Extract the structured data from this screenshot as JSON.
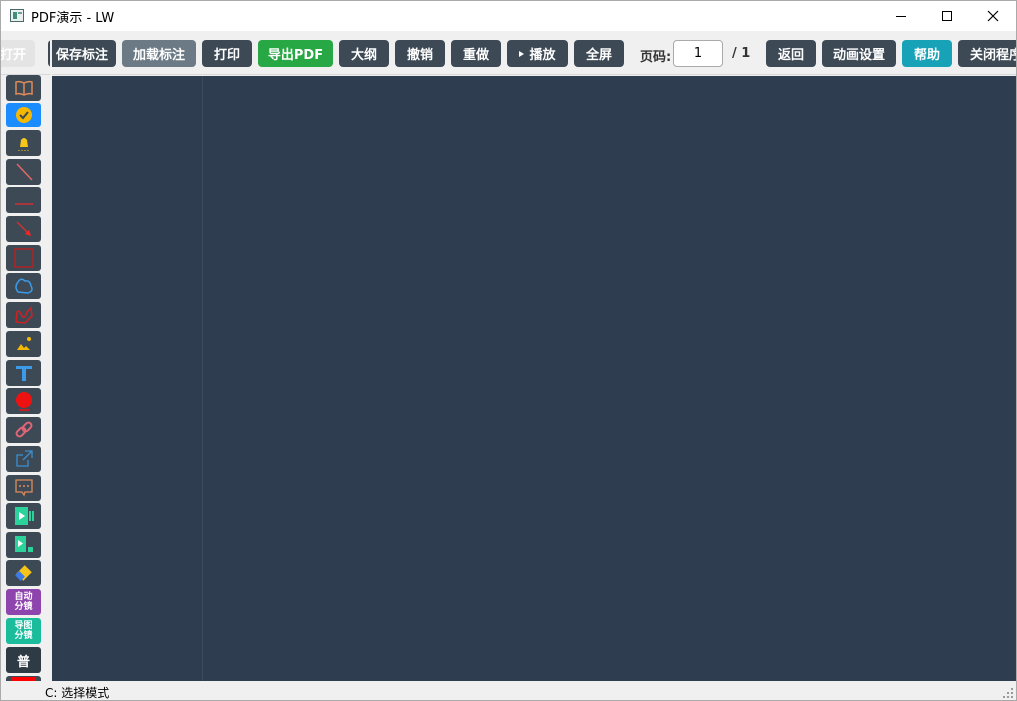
{
  "window": {
    "title": "PDF演示 - LW"
  },
  "toolbar": {
    "open_label": "打开",
    "save_annotation_label": "保存标注",
    "load_annotation_label": "加载标注",
    "print_label": "打印",
    "export_pdf_label": "导出PDF",
    "outline_label": "大纲",
    "undo_label": "撤销",
    "redo_label": "重做",
    "play_label": "播放",
    "fullscreen_label": "全屏",
    "page_label": "页码:",
    "page_value": "1",
    "page_total": "/ 1",
    "back_label": "返回",
    "animation_settings_label": "动画设置",
    "help_label": "帮助",
    "close_program_label": "关闭程序",
    "colors": {
      "primary": "#3d4a55",
      "secondary": "#6c7a86",
      "success": "#28a745",
      "info": "#17a2b8"
    }
  },
  "sidebar": {
    "tools": [
      {
        "name": "outline-book-icon"
      },
      {
        "name": "select-check-icon",
        "active": true
      },
      {
        "name": "bell-icon"
      },
      {
        "name": "line-icon"
      },
      {
        "name": "dash-line-icon"
      },
      {
        "name": "arrow-icon"
      },
      {
        "name": "rectangle-icon"
      },
      {
        "name": "cloud-icon"
      },
      {
        "name": "freehand-icon"
      },
      {
        "name": "image-icon"
      },
      {
        "name": "text-icon"
      },
      {
        "name": "stamp-icon"
      },
      {
        "name": "link-icon"
      },
      {
        "name": "external-link-icon"
      },
      {
        "name": "comment-icon"
      },
      {
        "name": "video-icon"
      },
      {
        "name": "audio-video-icon"
      },
      {
        "name": "eraser-icon"
      }
    ],
    "auto_storyboard_label": "自动\n分镜",
    "guided_storyboard_label": "导图\n分镜",
    "sound_label": "普",
    "current_color": "#ff0000"
  },
  "status": {
    "text": "C: 选择模式"
  }
}
